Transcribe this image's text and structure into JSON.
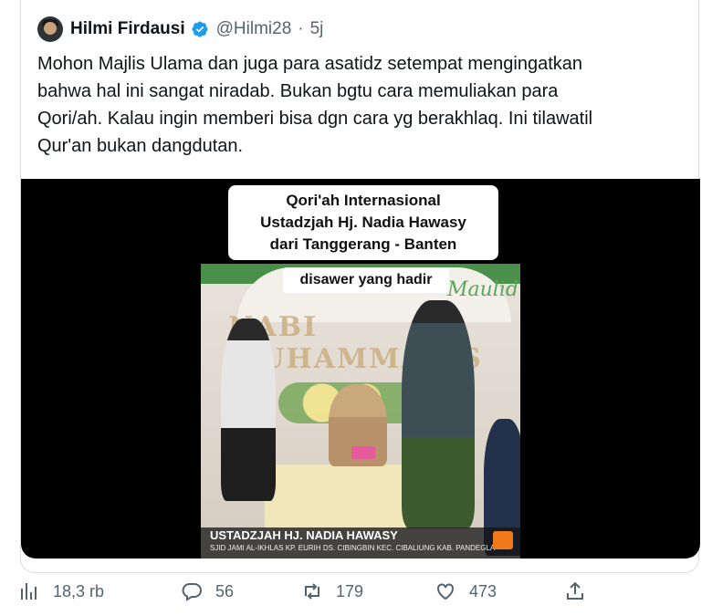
{
  "tweet": {
    "author": {
      "display_name": "Hilmi Firdausi",
      "handle": "@Hilmi28",
      "separator": "·",
      "time": "5j",
      "verified_icon": "verified-badge-icon",
      "verified_color": "#1d9bf0"
    },
    "text": "Mohon Majlis Ulama dan juga para asatidz setempat mengingatkan\nbahwa hal ini sangat niradab. Bukan bgtu cara memuliakan para\nQori/ah. Kalau ingin memberi bisa dgn cara yg berakhlaq. Ini tilawatil\nQur'an bukan dangdutan."
  },
  "media": {
    "title_lines": [
      "Qori'ah Internasional",
      "Ustadzjah Hj. Nadia Hawasy",
      "dari Tanggerang - Banten"
    ],
    "caption": "disawer yang hadir",
    "banner_text": "Maulid",
    "banner_heading": "NABI MUHAMMAD S",
    "lower_third_name": "USTADZJAH HJ. NADIA HAWASY",
    "lower_third_sub": "SJID JAMI AL-IKHLAS KP. EURIH DS. CIBINGBIN KEC. CIBALIUNG KAB. PANDEGLA"
  },
  "actions": {
    "views": {
      "count": "18,3 rb",
      "icon": "views-bar-chart-icon"
    },
    "reply": {
      "count": "56",
      "icon": "reply-bubble-icon"
    },
    "retweet": {
      "count": "179",
      "icon": "retweet-icon"
    },
    "like": {
      "count": "473",
      "icon": "heart-icon"
    },
    "share": {
      "icon": "share-upload-icon"
    }
  },
  "colors": {
    "text": "#0f1419",
    "secondary": "#536471",
    "border": "#d8dde1",
    "media_bg": "#000000"
  }
}
